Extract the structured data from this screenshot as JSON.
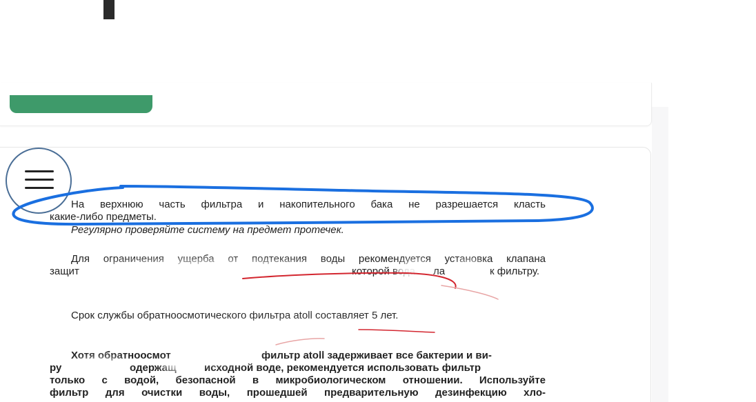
{
  "document": {
    "line1": "На верхнюю часть фильтра и накопительного бака не разрешается класть",
    "line2": "какие-либо предметы.",
    "line3": "Регулярно проверяйте систему на предмет протечек.",
    "line4": "Для ограничения ущерба от подтекания воды рекомендуется установка клапана",
    "line5a": "защит",
    "line5b": "которой вода",
    "line5c": "ла",
    "line5d": "к фильтру.",
    "line6": "Срок службы обратноосмотического фильтра atoll составляет 5 лет.",
    "line7a": "Хотя обратноосмот",
    "line7b": "фильтр atoll задерживает все бактерии и ви-",
    "line8a": "ру",
    "line8b": "одержащ",
    "line8c": "исходной воде, рекомендуется использовать фильтр",
    "line9": "только с водой, безопасной в микробиологическом отношении. Используйте",
    "line10": "фильтр для очистки воды, прошедшей предварительную дезинфекцию хло-"
  },
  "colors": {
    "accent_green": "#3e9a6a",
    "annotation_blue": "#1a6fe0",
    "annotation_red": "#d3262f",
    "menu_circle": "#4a6e96"
  },
  "icons": {
    "menu": "hamburger-menu-icon"
  }
}
